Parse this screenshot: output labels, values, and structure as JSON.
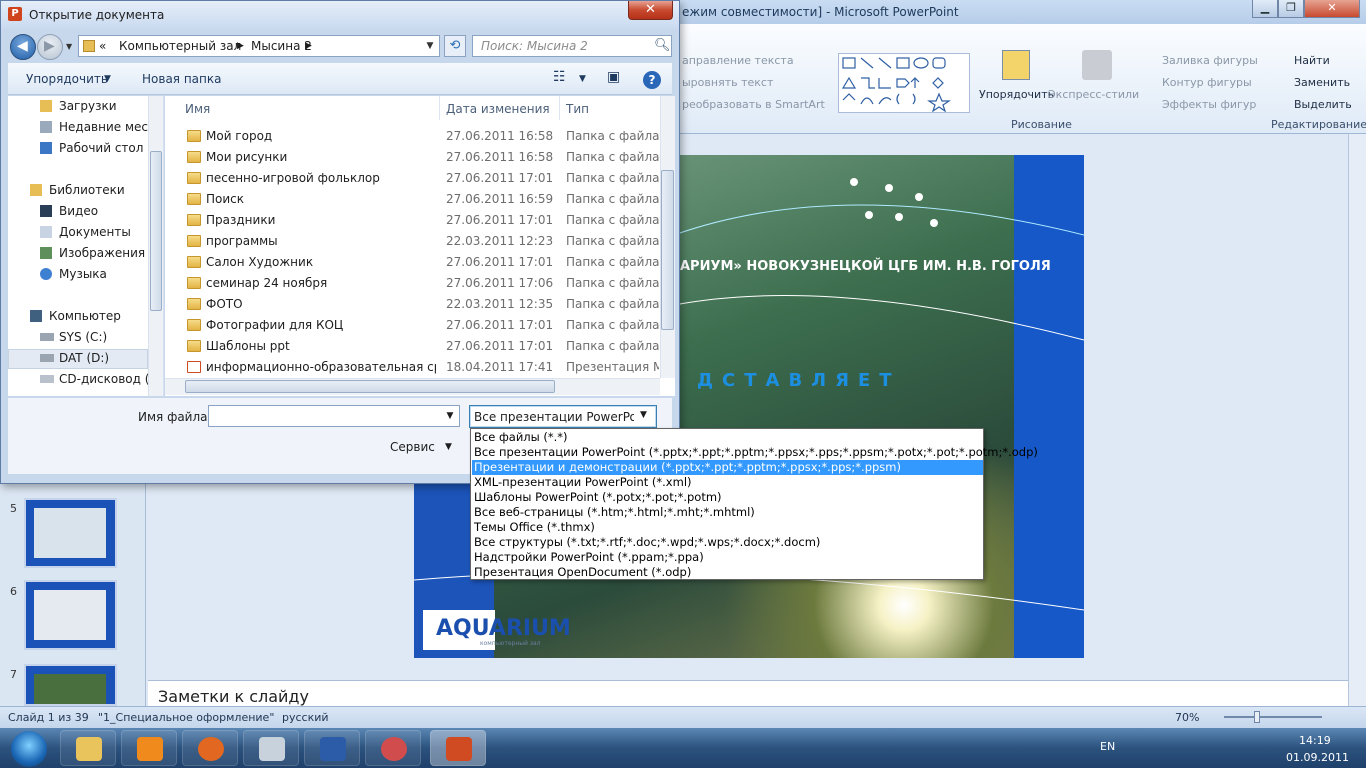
{
  "powerpoint": {
    "title": "ежим совместимости] - Microsoft PowerPoint",
    "ribbon": {
      "text_direction": "аправление текста",
      "align_text": "ыровнять текст",
      "convert_smartart": "реобразовать в SmartArt",
      "arrange": "Упорядочить",
      "quick_styles": "Экспресс-стили",
      "shape_fill": "Заливка фигуры",
      "shape_outline": "Контур фигуры",
      "shape_effects": "Эффекты фигур",
      "find": "Найти",
      "replace": "Заменить",
      "select": "Выделить",
      "group_drawing": "Рисование",
      "group_editing": "Редактирование"
    },
    "slide": {
      "heading": "АРИУМ» НОВОКУЗНЕЦКОЙ ЦГБ ИМ. Н.В. ГОГОЛЯ",
      "presents": "ДСТАВЛЯЕТ",
      "logo": "AQUARIUM",
      "logo_sub": "компьютерный зал"
    },
    "thumbnails": [
      "5",
      "6",
      "7"
    ],
    "notes_placeholder": "Заметки к слайду",
    "status": {
      "slide_info": "Слайд 1 из 39",
      "theme": "\"1_Специальное оформление\"",
      "language": "русский",
      "zoom": "70%"
    }
  },
  "taskbar": {
    "lang": "EN",
    "time": "14:19",
    "date": "01.09.2011"
  },
  "dialog": {
    "title": "Открытие документа",
    "address": {
      "prefix": "«",
      "path1": "Компьютерный зал",
      "path2": "Мысина 2"
    },
    "search_placeholder": "Поиск: Мысина 2",
    "toolbar": {
      "organize": "Упорядочить",
      "new_folder": "Новая папка"
    },
    "nav": [
      {
        "label": "Загрузки"
      },
      {
        "label": "Недавние места"
      },
      {
        "label": "Рабочий стол"
      },
      {
        "label": "Библиотеки"
      },
      {
        "label": "Видео"
      },
      {
        "label": "Документы"
      },
      {
        "label": "Изображения"
      },
      {
        "label": "Музыка"
      },
      {
        "label": "Компьютер"
      },
      {
        "label": "SYS (C:)"
      },
      {
        "label": "DAT (D:)"
      },
      {
        "label": "CD-дисковод (E:"
      }
    ],
    "columns": {
      "name": "Имя",
      "date": "Дата изменения",
      "type": "Тип"
    },
    "files": [
      {
        "name": "Мой город",
        "date": "27.06.2011 16:58",
        "type": "Папка с файлами"
      },
      {
        "name": "Мои рисунки",
        "date": "27.06.2011 16:58",
        "type": "Папка с файлами"
      },
      {
        "name": "песенно-игровой фольклор",
        "date": "27.06.2011 17:01",
        "type": "Папка с файлами"
      },
      {
        "name": "Поиск",
        "date": "27.06.2011 16:59",
        "type": "Папка с файлами"
      },
      {
        "name": "Праздники",
        "date": "27.06.2011 17:01",
        "type": "Папка с файлами"
      },
      {
        "name": "программы",
        "date": "22.03.2011 12:23",
        "type": "Папка с файлами"
      },
      {
        "name": "Салон Художник",
        "date": "27.06.2011 17:01",
        "type": "Папка с файлами"
      },
      {
        "name": "семинар 24 ноября",
        "date": "27.06.2011 17:06",
        "type": "Папка с файлами"
      },
      {
        "name": "ФОТО",
        "date": "22.03.2011 12:35",
        "type": "Папка с файлами"
      },
      {
        "name": "Фотографии для КОЦ",
        "date": "27.06.2011 17:01",
        "type": "Папка с файлами"
      },
      {
        "name": "Шаблоны ppt",
        "date": "27.06.2011 17:01",
        "type": "Папка с файлами"
      },
      {
        "name": "информационно-образовательная сре...",
        "date": "18.04.2011 17:41",
        "type": "Презентация Microsoft"
      }
    ],
    "filename_label": "Имя файла:",
    "filename_value": "",
    "filetype_selected": "Все презентации PowerPoint (",
    "service": "Сервис",
    "filetype_options": [
      {
        "label": "Все файлы (*.*)"
      },
      {
        "label": "Все презентации PowerPoint (*.pptx;*.ppt;*.pptm;*.ppsx;*.pps;*.ppsm;*.potx;*.pot;*.potm;*.odp)"
      },
      {
        "label": "Презентации и демонстрации (*.pptx;*.ppt;*.pptm;*.ppsx;*.pps;*.ppsm)"
      },
      {
        "label": "XML-презентации PowerPoint (*.xml)"
      },
      {
        "label": "Шаблоны PowerPoint (*.potx;*.pot;*.potm)"
      },
      {
        "label": "Все веб-страницы (*.htm;*.html;*.mht;*.mhtml)"
      },
      {
        "label": "Темы Office (*.thmx)"
      },
      {
        "label": "Все структуры (*.txt;*.rtf;*.doc;*.wpd;*.wps;*.docx;*.docm)"
      },
      {
        "label": "Надстройки PowerPoint (*.ppam;*.ppa)"
      },
      {
        "label": "Презентация OpenDocument (*.odp)"
      }
    ],
    "selected_option_index": 2
  }
}
